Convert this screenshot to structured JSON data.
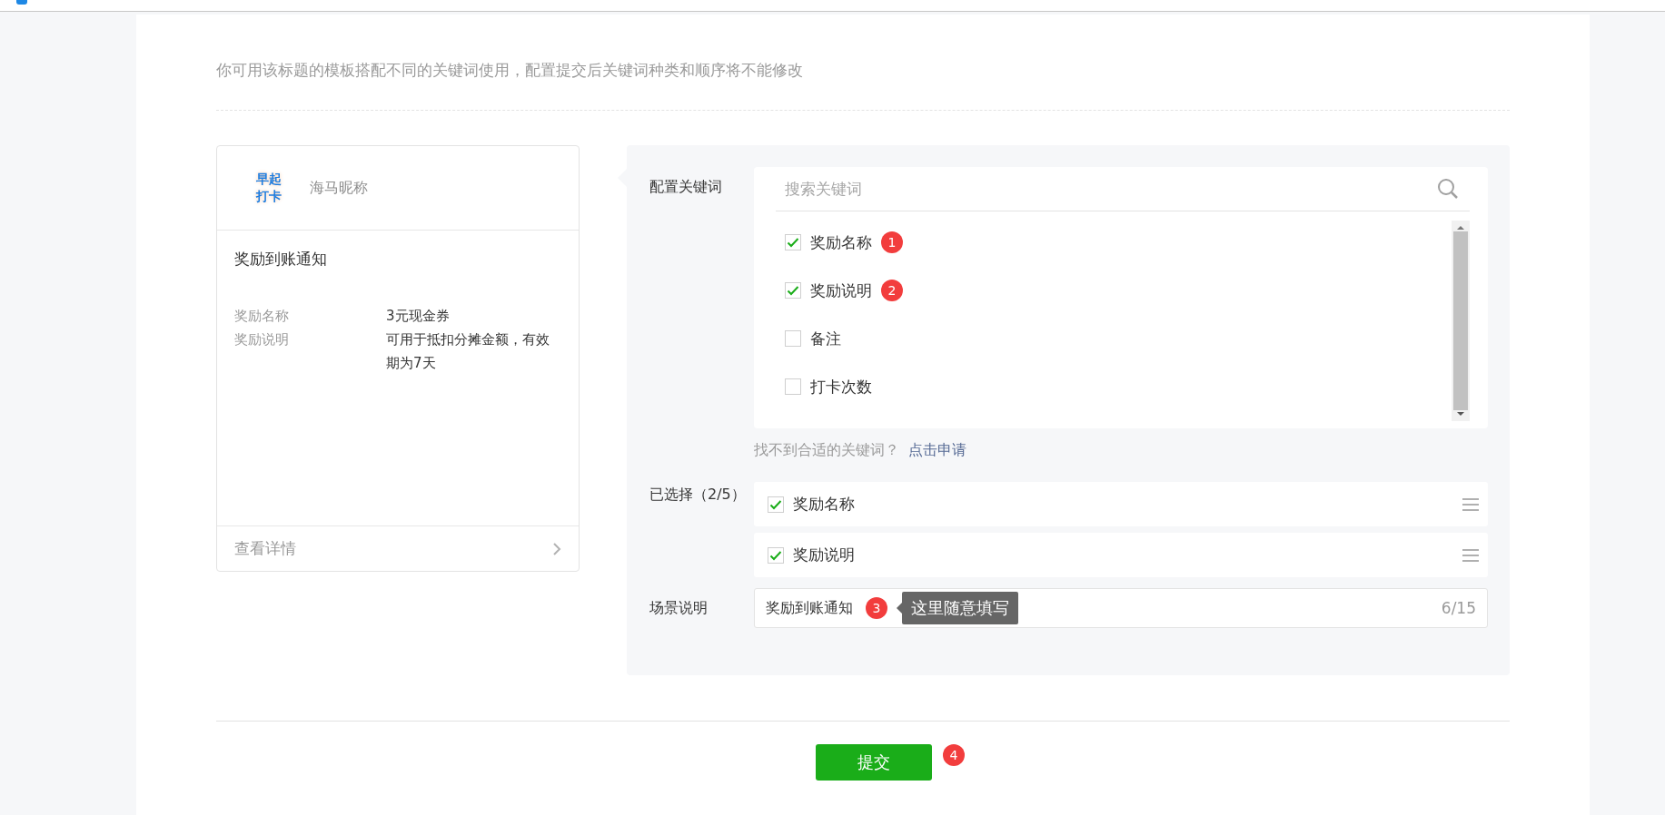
{
  "hint": "你可用该标题的模板搭配不同的关键词使用，配置提交后关键词种类和顺序将不能修改",
  "preview": {
    "logo_lines": [
      "早起",
      "打卡"
    ],
    "nickname": "海马昵称",
    "title": "奖励到账通知",
    "fields": [
      {
        "label": "奖励名称",
        "value": "3元现金券"
      },
      {
        "label": "奖励说明",
        "value": "可用于抵扣分摊金额，有效期为7天"
      }
    ],
    "detail_link": "查看详情"
  },
  "keywords": {
    "label": "配置关键词",
    "search": {
      "placeholder": "搜索关键词"
    },
    "options": [
      {
        "name": "奖励名称",
        "checked": true,
        "badge": "1"
      },
      {
        "name": "奖励说明",
        "checked": true,
        "badge": "2"
      },
      {
        "name": "备注",
        "checked": false
      },
      {
        "name": "打卡次数",
        "checked": false
      }
    ],
    "missing_hint": "找不到合适的关键词？",
    "apply_link": "点击申请"
  },
  "selected": {
    "label": "已选择（2/5）",
    "items": [
      {
        "name": "奖励名称",
        "checked": true
      },
      {
        "name": "奖励说明",
        "checked": true
      }
    ]
  },
  "scene": {
    "label": "场景说明",
    "value": "奖励到账通知",
    "counter": "6/15",
    "badge": "3",
    "tooltip": "这里随意填写"
  },
  "submit": {
    "label": "提交",
    "badge": "4"
  }
}
